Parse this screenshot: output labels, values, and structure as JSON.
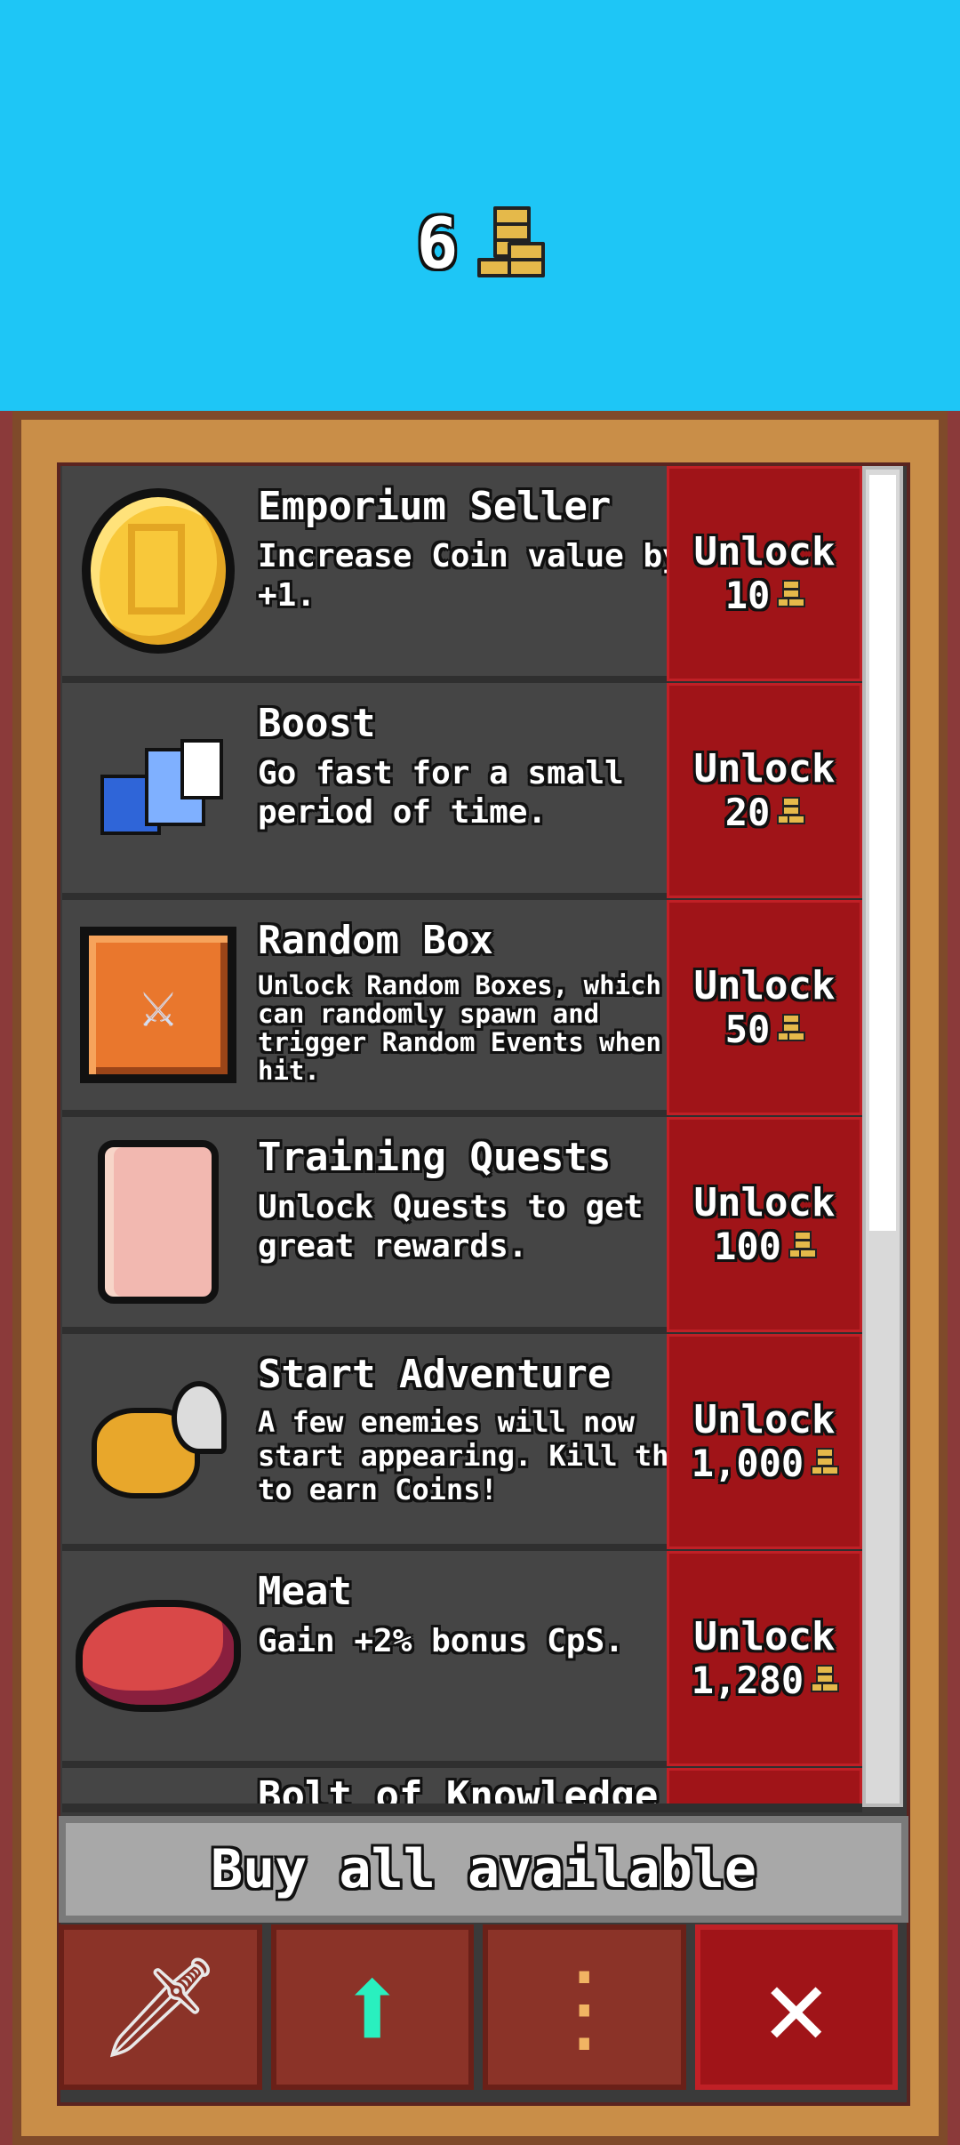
{
  "currency": {
    "amount": "6",
    "icon": "coin-stack-icon"
  },
  "upgrades": [
    {
      "title": "Emporium Seller",
      "description": "Increase Coin value by +1.",
      "button_label": "Unlock",
      "cost": "10",
      "icon": "gold-coin-icon"
    },
    {
      "title": "Boost",
      "description": "Go fast for a small period of time.",
      "button_label": "Unlock",
      "cost": "20",
      "icon": "boost-icon"
    },
    {
      "title": "Random Box",
      "description": "Unlock Random Boxes, which can randomly spawn and trigger Random Events when hit.",
      "button_label": "Unlock",
      "cost": "50",
      "icon": "random-box-icon"
    },
    {
      "title": "Training Quests",
      "description": "Unlock Quests to get great rewards.",
      "button_label": "Unlock",
      "cost": "100",
      "icon": "scroll-icon"
    },
    {
      "title": "Start Adventure",
      "description": "A few enemies will now start appearing. Kill them to earn Coins!",
      "button_label": "Unlock",
      "cost": "1,000",
      "icon": "bee-icon"
    },
    {
      "title": "Meat",
      "description": "Gain +2% bonus CpS.",
      "button_label": "Unlock",
      "cost": "1,280",
      "icon": "meat-icon"
    },
    {
      "title": "Bolt of Knowledge",
      "description": "",
      "button_label": "",
      "cost": "",
      "icon": ""
    }
  ],
  "buy_all_label": "Buy all available",
  "tabs": [
    {
      "name": "sword-icon"
    },
    {
      "name": "upgrade-arrow-icon"
    },
    {
      "name": "more-options-icon"
    },
    {
      "name": "close-icon"
    }
  ],
  "colors": {
    "sky": "#1ec6f6",
    "unlock": "#a01418",
    "panel": "#3a3a3a",
    "frame": "#c98e48"
  }
}
